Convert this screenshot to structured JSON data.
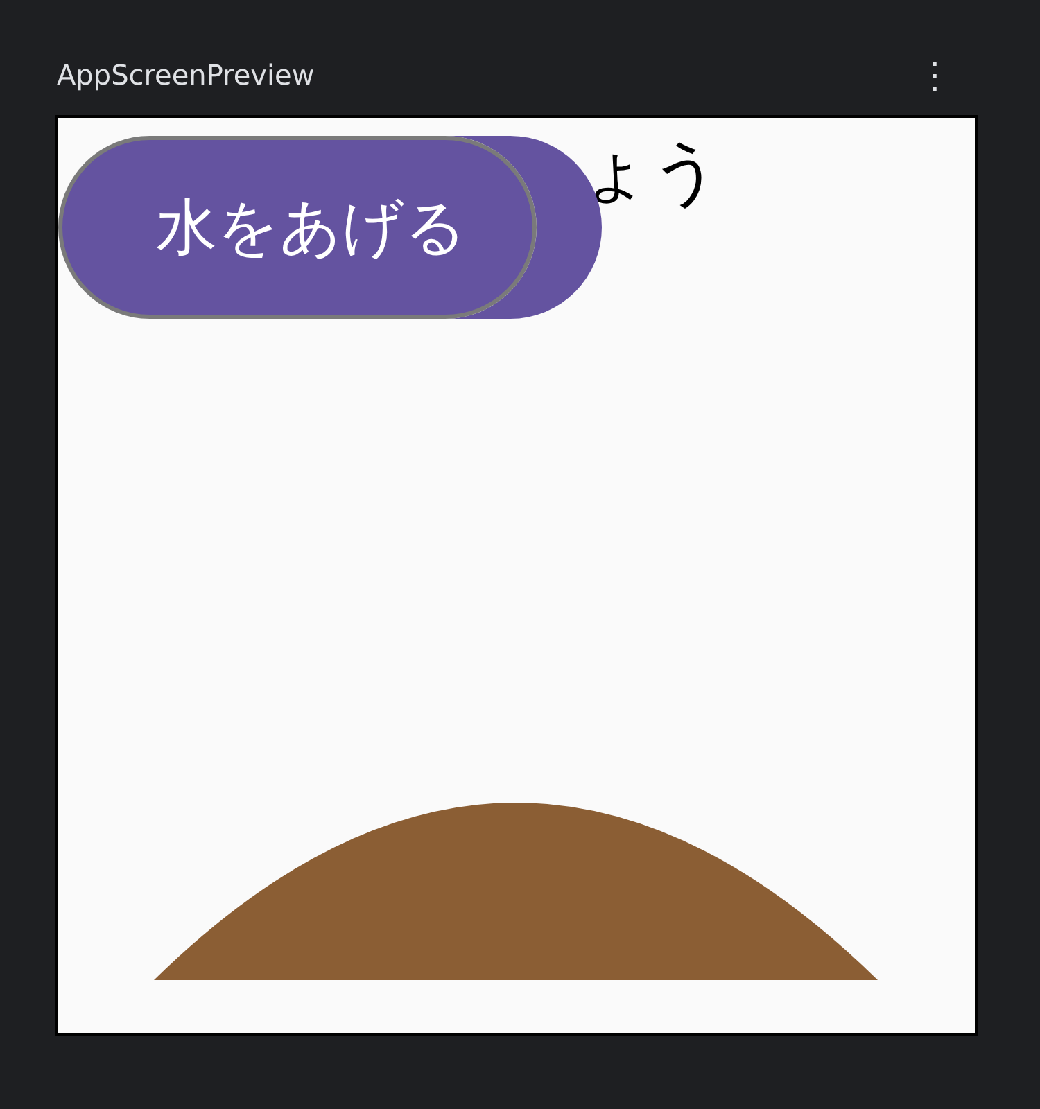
{
  "window": {
    "title": "AppScreenPreview",
    "menu_icon": "⋮"
  },
  "preview": {
    "heading": "ょう",
    "button": {
      "label": "水をあげる"
    }
  }
}
